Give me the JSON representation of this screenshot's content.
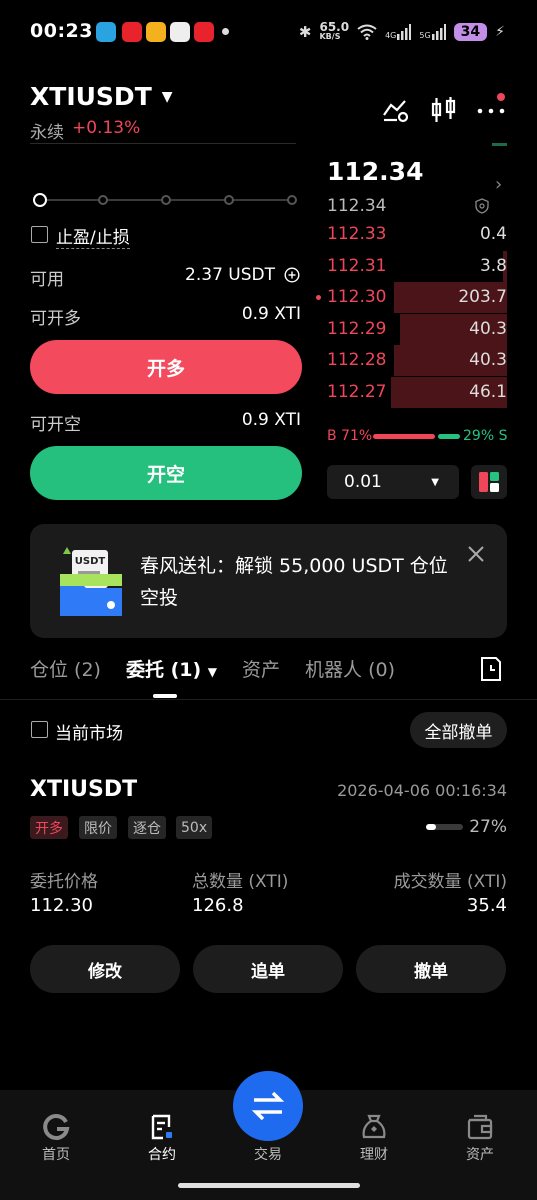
{
  "status_bar": {
    "time": "00:23",
    "net_speed": "65.0",
    "net_unit": "KB/S",
    "sig1": "4G",
    "sig2": "5G",
    "battery": "34"
  },
  "header": {
    "pair": "XTIUSDT",
    "contract_type": "永续",
    "change": "+0.13%"
  },
  "form": {
    "tpsl_label": "止盈/止损",
    "available_label": "可用",
    "available_value": "2.37 USDT",
    "open_long_label": "可开多",
    "open_long_value": "0.9 XTI",
    "open_short_label": "可开空",
    "open_short_value": "0.9 XTI",
    "long_button": "开多",
    "short_button": "开空"
  },
  "orderbook": {
    "last_price": "112.34",
    "mark_price": "112.34",
    "asks": [
      {
        "price": "112.33",
        "qty": "0.4",
        "depth": 0.0
      },
      {
        "price": "112.31",
        "qty": "3.8",
        "depth": 0.02
      },
      {
        "price": "112.30",
        "qty": "203.7",
        "depth": 0.58
      },
      {
        "price": "112.29",
        "qty": "40.3",
        "depth": 0.55
      },
      {
        "price": "112.28",
        "qty": "40.3",
        "depth": 0.58
      },
      {
        "price": "112.27",
        "qty": "46.1",
        "depth": 0.6
      }
    ],
    "buy_ratio": "B 71%",
    "sell_ratio": "29% S",
    "precision": "0.01"
  },
  "promo": {
    "text": "春风送礼：解锁 55,000 USDT 仓位空投",
    "badge": "USDT"
  },
  "tabs": [
    {
      "label": "仓位 (2)"
    },
    {
      "label": "委托 (1)"
    },
    {
      "label": "资产"
    },
    {
      "label": "机器人 (0)"
    }
  ],
  "filter": {
    "current_market": "当前市场",
    "cancel_all": "全部撤单"
  },
  "order": {
    "symbol": "XTIUSDT",
    "time": "2026-04-06 00:16:34",
    "tags": [
      "开多",
      "限价",
      "逐仓",
      "50x"
    ],
    "fill_pct": "27%",
    "price_label": "委托价格",
    "price": "112.30",
    "total_label": "总数量 (XTI)",
    "total": "126.8",
    "filled_label": "成交数量 (XTI)",
    "filled": "35.4",
    "actions": [
      "修改",
      "追单",
      "撤单"
    ]
  },
  "nav": [
    {
      "label": "首页"
    },
    {
      "label": "合约"
    },
    {
      "label": "交易"
    },
    {
      "label": "理财"
    },
    {
      "label": "资产"
    }
  ]
}
